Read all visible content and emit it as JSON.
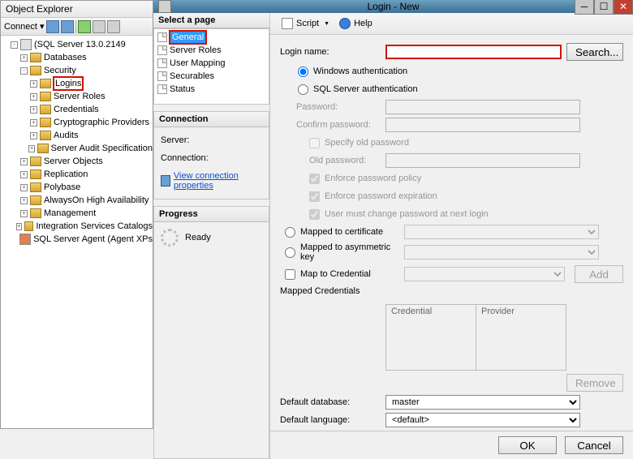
{
  "objectExplorer": {
    "title": "Object Explorer",
    "connectLabel": "Connect ▾",
    "server": "(SQL Server 13.0.2149",
    "nodes": {
      "databases": "Databases",
      "security": "Security",
      "logins": "Logins",
      "serverRoles": "Server Roles",
      "credentials": "Credentials",
      "cryptoProviders": "Cryptographic Providers",
      "audits": "Audits",
      "serverAuditSpec": "Server Audit Specification",
      "serverObjects": "Server Objects",
      "replication": "Replication",
      "polybase": "Polybase",
      "alwaysOn": "AlwaysOn High Availability",
      "management": "Management",
      "integrationServices": "Integration Services Catalogs",
      "sqlAgent": "SQL Server Agent (Agent XPs"
    }
  },
  "dialog": {
    "title": "Login - New",
    "toolbar": {
      "script": "Script",
      "help": "Help"
    },
    "pages": {
      "header": "Select a page",
      "general": "General",
      "serverRoles": "Server Roles",
      "userMapping": "User Mapping",
      "securables": "Securables",
      "status": "Status"
    },
    "connection": {
      "header": "Connection",
      "serverLabel": "Server:",
      "connectionLabel": "Connection:",
      "viewProps": "View connection properties"
    },
    "progress": {
      "header": "Progress",
      "ready": "Ready"
    },
    "form": {
      "loginName": "Login name:",
      "search": "Search...",
      "winAuth": "Windows authentication",
      "sqlAuth": "SQL Server authentication",
      "password": "Password:",
      "confirmPassword": "Confirm password:",
      "specifyOld": "Specify old password",
      "oldPassword": "Old password:",
      "enforcePolicy": "Enforce password policy",
      "enforceExpiration": "Enforce password expiration",
      "mustChange": "User must change password at next login",
      "mappedCert": "Mapped to certificate",
      "mappedAsymKey": "Mapped to asymmetric key",
      "mapToCredential": "Map to Credential",
      "add": "Add",
      "mappedCredentials": "Mapped Credentials",
      "credentialCol": "Credential",
      "providerCol": "Provider",
      "remove": "Remove",
      "defaultDatabase": "Default database:",
      "defaultDbValue": "master",
      "defaultLanguage": "Default language:",
      "defaultLangValue": "<default>"
    },
    "footer": {
      "ok": "OK",
      "cancel": "Cancel"
    }
  }
}
